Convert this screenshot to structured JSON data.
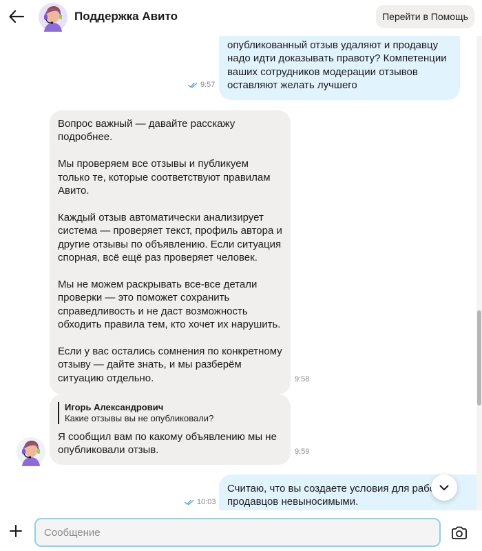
{
  "header": {
    "title": "Поддержка Авито",
    "help_button": "Перейти в Помощь"
  },
  "messages": [
    {
      "direction": "outgoing",
      "text": "опубликованный отзыв удаляют и продавцу надо идти доказывать правоту? Компетенции ваших сотрудников модерации отзывов оставляют желать лучшего",
      "time": "9:57",
      "read": true
    },
    {
      "direction": "incoming",
      "text": "Вопрос важный — давайте расскажу подробнее.\n\nМы проверяем все отзывы и публикуем только те, которые соответствуют правилам Авито.\n\nКаждый отзыв автоматически анализирует система — проверяет текст, профиль автора и другие отзывы по объявлению. Если ситуация спорная, всё ещё раз проверяет человек.\n\nМы не можем раскрывать все-все детали проверки — это поможет сохранить справедливость и не даст возможность обходить правила тем, кто хочет их нарушить.\n\nЕсли у вас остались сомнения по конкретному отзыву — дайте знать, и мы разберём ситуацию отдельно.",
      "time": "9:58"
    },
    {
      "direction": "incoming",
      "quote": {
        "author": "Игорь Александрович",
        "text": "Какие отзывы вы не опубликовали?"
      },
      "text": "Я сообщил вам по какому объявлению мы не опубликовали отзыв.",
      "time": "9:59"
    },
    {
      "direction": "outgoing",
      "text": "Считаю, что вы создаете условия для работы продавцов невыносимыми.",
      "time": "10:03",
      "read": true
    }
  ],
  "composer": {
    "placeholder": "Сообщение"
  },
  "icons": {
    "back": "arrow-left-icon",
    "add": "plus-icon",
    "camera": "camera-icon",
    "scroll_down": "chevron-down-icon",
    "read_receipt": "double-check-icon"
  },
  "colors": {
    "outgoing_bubble": "#e1f3fc",
    "incoming_bubble": "#f0efed",
    "input_border": "#8ed0f5",
    "read_check": "#4aa6d8"
  }
}
